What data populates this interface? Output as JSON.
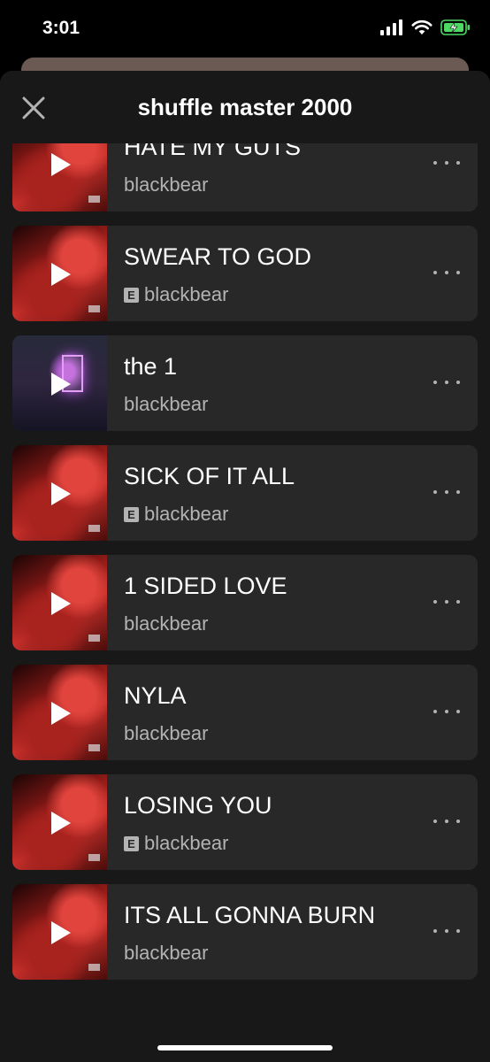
{
  "status": {
    "time": "3:01",
    "signal_icon": "cellular-signal-icon",
    "wifi_icon": "wifi-icon",
    "battery_icon": "battery-charging-icon",
    "battery_color": "#4cd964"
  },
  "sheet": {
    "title": "shuffle master 2000",
    "close_icon": "close-icon"
  },
  "tracks": [
    {
      "title": "",
      "artist": "blackbear",
      "explicit": false,
      "art": "art-photo",
      "playing_icon": false
    },
    {
      "title": "HATE MY GUTS",
      "artist": "blackbear",
      "explicit": false,
      "art": "art-red",
      "playing_icon": true
    },
    {
      "title": "SWEAR TO GOD",
      "artist": "blackbear",
      "explicit": true,
      "art": "art-red",
      "playing_icon": true
    },
    {
      "title": "the 1",
      "artist": "blackbear",
      "explicit": false,
      "art": "art-room",
      "playing_icon": true
    },
    {
      "title": "SICK OF IT ALL",
      "artist": "blackbear",
      "explicit": true,
      "art": "art-red",
      "playing_icon": true
    },
    {
      "title": "1 SIDED LOVE",
      "artist": "blackbear",
      "explicit": false,
      "art": "art-red",
      "playing_icon": true
    },
    {
      "title": "NYLA",
      "artist": "blackbear",
      "explicit": false,
      "art": "art-red",
      "playing_icon": true
    },
    {
      "title": "LOSING YOU",
      "artist": "blackbear",
      "explicit": true,
      "art": "art-red",
      "playing_icon": true
    },
    {
      "title": "ITS ALL GONNA BURN",
      "artist": "blackbear",
      "explicit": false,
      "art": "art-red",
      "playing_icon": true
    }
  ],
  "explicit_label": "E",
  "colors": {
    "background": "#181818",
    "row": "#282828",
    "secondary_text": "#b3b3b3"
  }
}
